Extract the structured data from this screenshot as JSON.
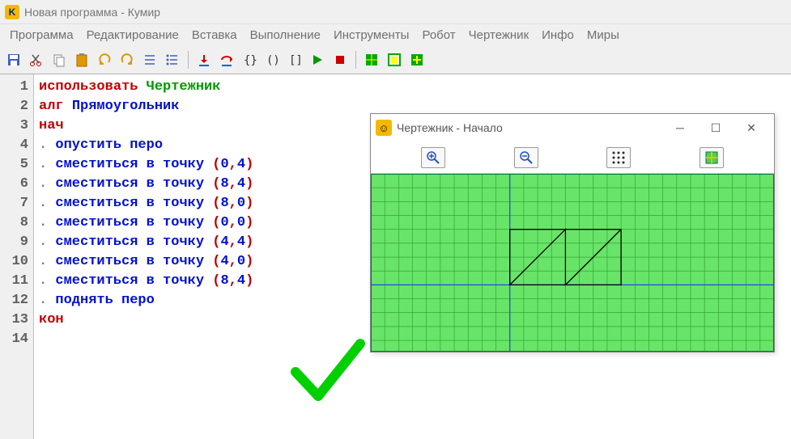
{
  "app": {
    "icon_letter": "K",
    "title": "Новая программа - Кумир"
  },
  "menu": [
    "Программа",
    "Редактирование",
    "Вставка",
    "Выполнение",
    "Инструменты",
    "Робот",
    "Чертежник",
    "Инфо",
    "Миры"
  ],
  "toolbar_icons": [
    "save-icon",
    "cut-icon",
    "copy-icon",
    "paste-icon",
    "undo-icon",
    "redo-icon",
    "list1-icon",
    "list2-icon",
    "sep",
    "step-in-icon",
    "step-over-icon",
    "brace-icon",
    "brace2-icon",
    "brace3-icon",
    "play-icon",
    "stop-icon",
    "sep",
    "grid-green-icon",
    "grid-outline-icon",
    "grid-plus-icon"
  ],
  "code": {
    "lines": [
      {
        "n": 1,
        "tokens": [
          {
            "t": "использовать ",
            "c": "kw-red"
          },
          {
            "t": "Чертежник",
            "c": "kw-green"
          }
        ]
      },
      {
        "n": 2,
        "tokens": [
          {
            "t": "алг ",
            "c": "kw-red"
          },
          {
            "t": "Прямоугольник",
            "c": "kw-blue"
          }
        ]
      },
      {
        "n": 3,
        "tokens": [
          {
            "t": "нач",
            "c": "kw-red"
          }
        ]
      },
      {
        "n": 4,
        "tokens": [
          {
            "t": ". ",
            "c": "dot"
          },
          {
            "t": "опустить перо",
            "c": "kw-blue"
          }
        ]
      },
      {
        "n": 5,
        "tokens": [
          {
            "t": ". ",
            "c": "dot"
          },
          {
            "t": "сместиться в точку ",
            "c": "kw-blue"
          },
          {
            "t": "(",
            "c": "paren"
          },
          {
            "t": "0",
            "c": "num"
          },
          {
            "t": ",",
            "c": "comma"
          },
          {
            "t": "4",
            "c": "num"
          },
          {
            "t": ")",
            "c": "paren"
          }
        ]
      },
      {
        "n": 6,
        "tokens": [
          {
            "t": ". ",
            "c": "dot"
          },
          {
            "t": "сместиться в точку ",
            "c": "kw-blue"
          },
          {
            "t": "(",
            "c": "paren"
          },
          {
            "t": "8",
            "c": "num"
          },
          {
            "t": ",",
            "c": "comma"
          },
          {
            "t": "4",
            "c": "num"
          },
          {
            "t": ")",
            "c": "paren"
          }
        ]
      },
      {
        "n": 7,
        "tokens": [
          {
            "t": ". ",
            "c": "dot"
          },
          {
            "t": "сместиться в точку ",
            "c": "kw-blue"
          },
          {
            "t": "(",
            "c": "paren"
          },
          {
            "t": "8",
            "c": "num"
          },
          {
            "t": ",",
            "c": "comma"
          },
          {
            "t": "0",
            "c": "num"
          },
          {
            "t": ")",
            "c": "paren"
          }
        ]
      },
      {
        "n": 8,
        "tokens": [
          {
            "t": ". ",
            "c": "dot"
          },
          {
            "t": "сместиться в точку ",
            "c": "kw-blue"
          },
          {
            "t": "(",
            "c": "paren"
          },
          {
            "t": "0",
            "c": "num"
          },
          {
            "t": ",",
            "c": "comma"
          },
          {
            "t": "0",
            "c": "num"
          },
          {
            "t": ")",
            "c": "paren"
          }
        ]
      },
      {
        "n": 9,
        "tokens": [
          {
            "t": ". ",
            "c": "dot"
          },
          {
            "t": "сместиться в точку ",
            "c": "kw-blue"
          },
          {
            "t": "(",
            "c": "paren"
          },
          {
            "t": "4",
            "c": "num"
          },
          {
            "t": ",",
            "c": "comma"
          },
          {
            "t": "4",
            "c": "num"
          },
          {
            "t": ")",
            "c": "paren"
          }
        ]
      },
      {
        "n": 10,
        "tokens": [
          {
            "t": ". ",
            "c": "dot"
          },
          {
            "t": "сместиться в точку ",
            "c": "kw-blue"
          },
          {
            "t": "(",
            "c": "paren"
          },
          {
            "t": "4",
            "c": "num"
          },
          {
            "t": ",",
            "c": "comma"
          },
          {
            "t": "0",
            "c": "num"
          },
          {
            "t": ")",
            "c": "paren"
          }
        ]
      },
      {
        "n": 11,
        "tokens": [
          {
            "t": ". ",
            "c": "dot"
          },
          {
            "t": "сместиться в точку ",
            "c": "kw-blue"
          },
          {
            "t": "(",
            "c": "paren"
          },
          {
            "t": "8",
            "c": "num"
          },
          {
            "t": ",",
            "c": "comma"
          },
          {
            "t": "4",
            "c": "num"
          },
          {
            "t": ")",
            "c": "paren"
          }
        ]
      },
      {
        "n": 12,
        "tokens": [
          {
            "t": ". ",
            "c": "dot"
          },
          {
            "t": "поднять перо",
            "c": "kw-blue"
          }
        ]
      },
      {
        "n": 13,
        "tokens": [
          {
            "t": "кон",
            "c": "kw-red"
          }
        ]
      },
      {
        "n": 14,
        "tokens": []
      }
    ]
  },
  "drawer": {
    "title": "Чертежник - Начало",
    "canvas": {
      "grid_color": "#68e468",
      "grid_line": "#2a9a2a",
      "axis_color": "#2040ff",
      "origin_cell": {
        "col": 10,
        "row": 8,
        "cols": 29,
        "rows": 13
      },
      "path": [
        [
          0,
          0
        ],
        [
          0,
          4
        ],
        [
          8,
          4
        ],
        [
          8,
          0
        ],
        [
          0,
          0
        ],
        [
          4,
          4
        ],
        [
          4,
          0
        ],
        [
          8,
          4
        ]
      ]
    }
  }
}
